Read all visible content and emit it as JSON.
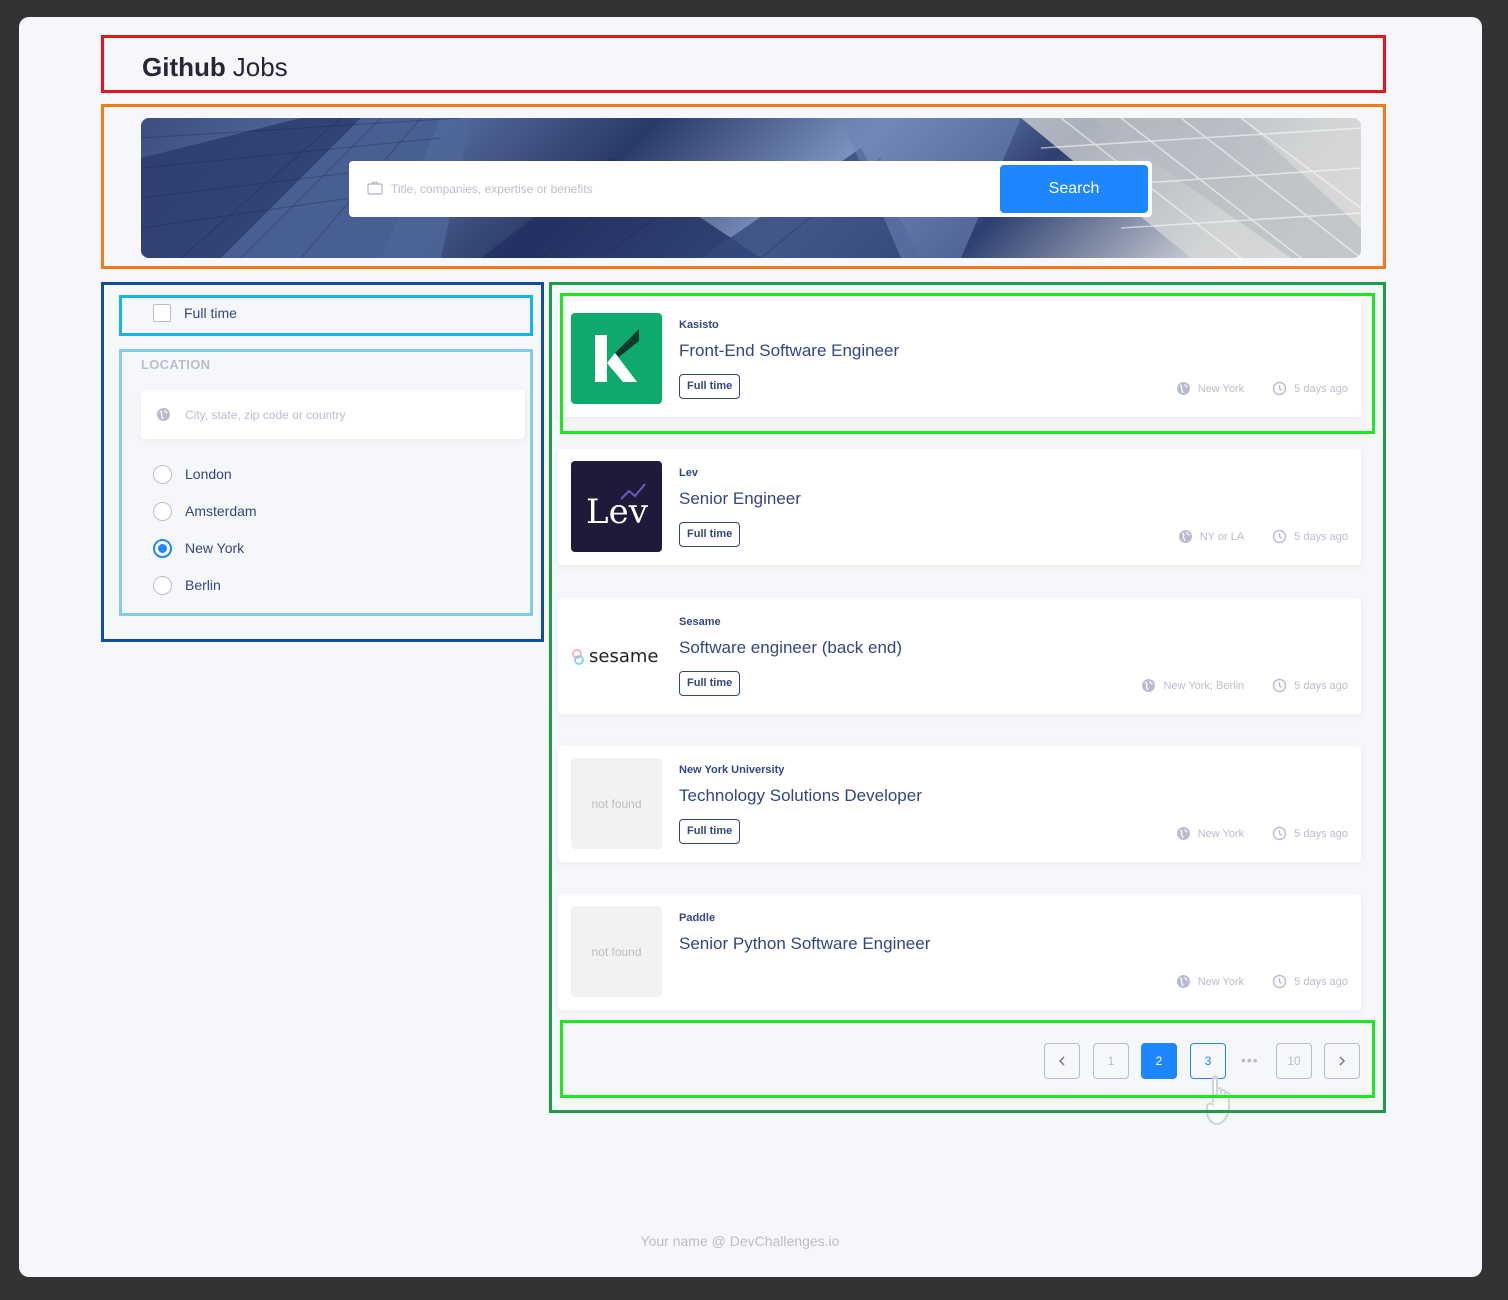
{
  "header": {
    "title_bold": "Github",
    "title_light": "Jobs"
  },
  "search": {
    "placeholder": "Title, companies, expertise or benefits",
    "button_label": "Search"
  },
  "filters": {
    "full_time_label": "Full time",
    "full_time_checked": false,
    "location_heading": "LOCATION",
    "location_placeholder": "City, state, zip code or country",
    "locations": [
      {
        "label": "London",
        "selected": false
      },
      {
        "label": "Amsterdam",
        "selected": false
      },
      {
        "label": "New York",
        "selected": true
      },
      {
        "label": "Berlin",
        "selected": false
      }
    ]
  },
  "jobs": [
    {
      "company": "Kasisto",
      "title": "Front-End Software Engineer",
      "badge": "Full time",
      "location": "New York",
      "posted": "5 days ago",
      "logo": "kasisto-logo"
    },
    {
      "company": "Lev",
      "title": "Senior Engineer",
      "badge": "Full time",
      "location": "NY or LA",
      "posted": "5 days ago",
      "logo": "lev-logo",
      "logo_text": "Lev"
    },
    {
      "company": "Sesame",
      "title": "Software engineer (back end)",
      "badge": "Full time",
      "location": "New York; Berlin",
      "posted": "5 days ago",
      "logo": "sesame-logo",
      "logo_text": "sesame"
    },
    {
      "company": "New York University",
      "title": "Technology Solutions Developer",
      "badge": "Full time",
      "location": "New York",
      "posted": "5 days ago",
      "logo": "not-found",
      "logo_text": "not found"
    },
    {
      "company": "Paddle",
      "title": "Senior Python Software Engineer",
      "badge": "",
      "location": "New York",
      "posted": "5 days ago",
      "logo": "not-found",
      "logo_text": "not found"
    }
  ],
  "pagination": {
    "pages": [
      "1",
      "2",
      "3",
      "10"
    ],
    "current": "2",
    "hovered": "3",
    "ellipsis": "•••"
  },
  "footer": {
    "text": "Your name @ DevChallenges.io"
  },
  "colors": {
    "accent": "#1E86FF",
    "text_primary": "#334680",
    "text_muted": "#B9BDCF",
    "background": "#F6F7FB"
  },
  "icons": [
    "briefcase-icon",
    "globe-icon",
    "clock-icon",
    "chevron-left-icon",
    "chevron-right-icon",
    "hand-cursor-icon"
  ]
}
